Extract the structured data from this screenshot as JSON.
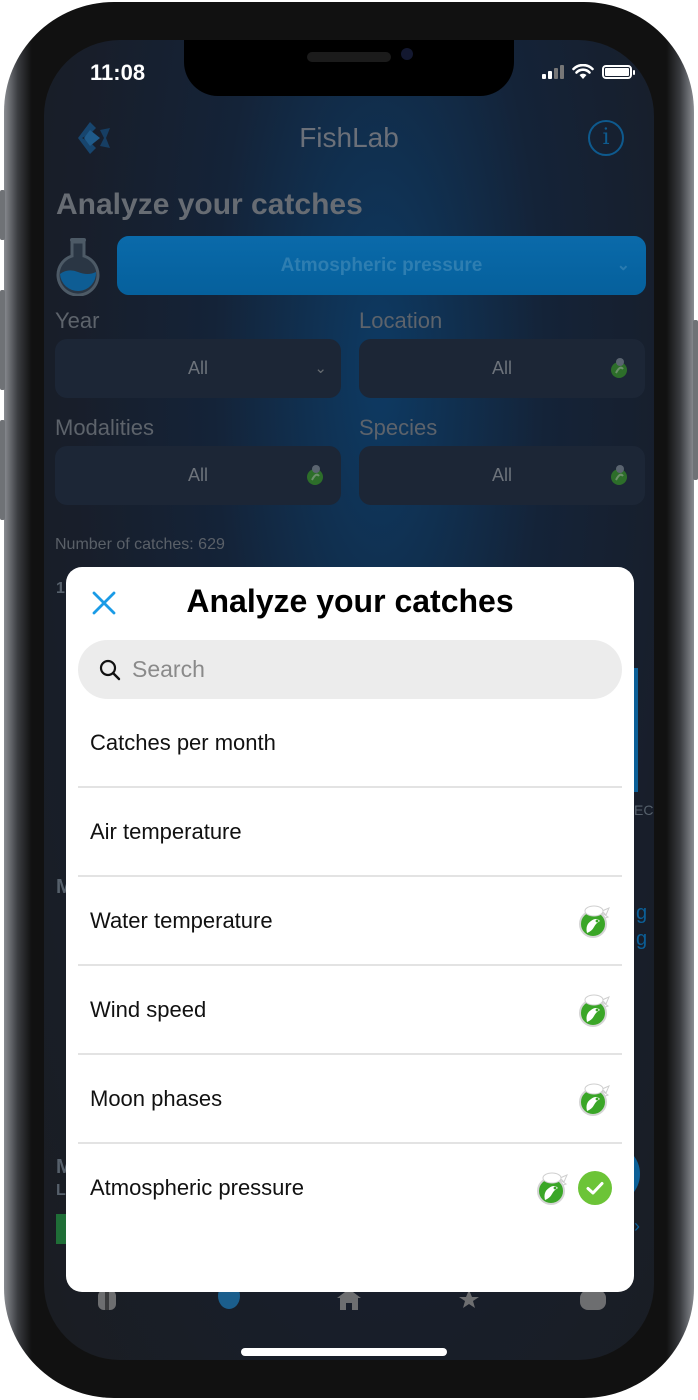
{
  "status_bar": {
    "time": "11:08"
  },
  "header": {
    "app_title": "FishLab",
    "logo_icon": "fishlab-logo-icon",
    "info_icon": "info-icon",
    "info_glyph": "i"
  },
  "page": {
    "title": "Analyze your catches",
    "analysis_select": {
      "value": "Atmospheric pressure",
      "icon": "flask-icon"
    },
    "filters": [
      {
        "label": "Year",
        "value": "All",
        "control": "chevron-down-icon"
      },
      {
        "label": "Location",
        "value": "All",
        "control": "premium-badge-icon"
      },
      {
        "label": "Modalities",
        "value": "All",
        "control": "premium-badge-icon"
      },
      {
        "label": "Species",
        "value": "All",
        "control": "premium-badge-icon"
      }
    ],
    "catches_count": "Number of catches: 629",
    "background_fragments": {
      "left_digit": "1",
      "right_month": "EC",
      "left_letter": "M",
      "right_g1": "g",
      "right_g2": "g",
      "left_m2": "M",
      "left_l": "L"
    }
  },
  "tabbar": {
    "items": [
      {
        "icon": "profile-tab-icon"
      },
      {
        "icon": "analysis-tab-icon",
        "active": true
      },
      {
        "icon": "home-tab-icon"
      },
      {
        "icon": "awards-tab-icon"
      },
      {
        "icon": "more-tab-icon"
      }
    ]
  },
  "modal": {
    "title": "Analyze your catches",
    "close_icon": "close-icon",
    "search": {
      "placeholder": "Search",
      "value": ""
    },
    "options": [
      {
        "label": "Catches per month",
        "premium": false,
        "selected": false
      },
      {
        "label": "Air temperature",
        "premium": false,
        "selected": false
      },
      {
        "label": "Water temperature",
        "premium": true,
        "selected": false
      },
      {
        "label": "Wind speed",
        "premium": true,
        "selected": false
      },
      {
        "label": "Moon phases",
        "premium": true,
        "selected": false
      },
      {
        "label": "Atmospheric pressure",
        "premium": true,
        "selected": true
      }
    ]
  },
  "colors": {
    "accent_blue": "#1a9be6",
    "selected_green": "#6cc437",
    "premium_green": "#3aa627",
    "select_blue": "#0a6aaa"
  }
}
